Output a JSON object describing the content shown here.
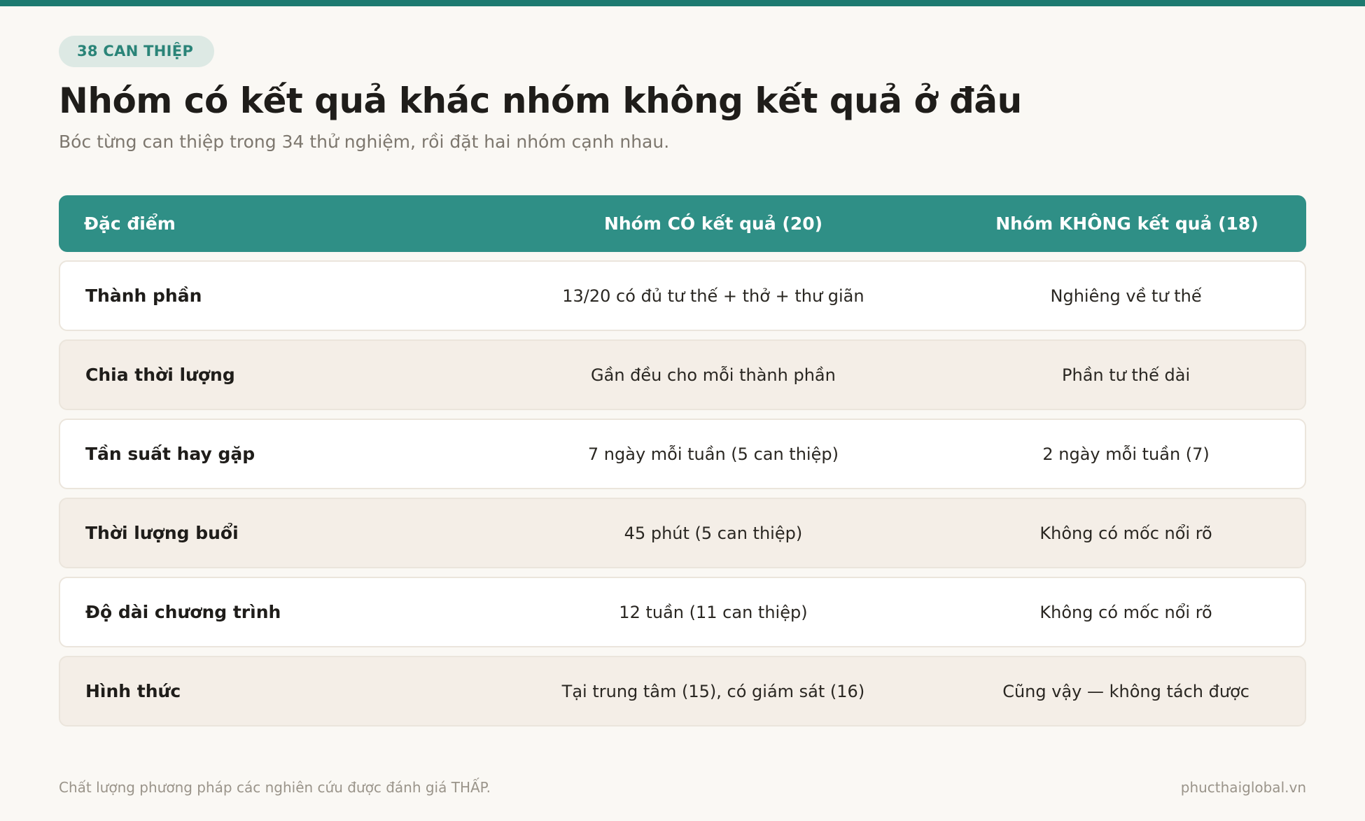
{
  "badge": "38 CAN THIỆP",
  "title": "Nhóm có kết quả khác nhóm không kết quả ở đâu",
  "subtitle": "Bóc từng can thiệp trong 34 thử nghiệm, rồi đặt hai nhóm cạnh nhau.",
  "table": {
    "headers": [
      "Đặc điểm",
      "Nhóm CÓ kết quả (20)",
      "Nhóm KHÔNG kết quả (18)"
    ],
    "rows": [
      [
        "Thành phần",
        "13/20 có đủ tư thế + thở + thư giãn",
        "Nghiêng về tư thế"
      ],
      [
        "Chia thời lượng",
        "Gần đều cho mỗi thành phần",
        "Phần tư thế dài"
      ],
      [
        "Tần suất hay gặp",
        "7 ngày mỗi tuần (5 can thiệp)",
        "2 ngày mỗi tuần (7)"
      ],
      [
        "Thời lượng buổi",
        "45 phút (5 can thiệp)",
        "Không có mốc nổi rõ"
      ],
      [
        "Độ dài chương trình",
        "12 tuần (11 can thiệp)",
        "Không có mốc nổi rõ"
      ],
      [
        "Hình thức",
        "Tại trung tâm (15), có giám sát (16)",
        "Cũng vậy — không tách được"
      ]
    ]
  },
  "footer": {
    "note": "Chất lượng phương pháp các nghiên cứu được đánh giá THẤP.",
    "site": "phucthaiglobal.vn"
  },
  "colors": {
    "accent": "#1d7a70",
    "header_bg": "#2f8f86",
    "badge_bg": "#dde9e4",
    "row_alt_bg": "#f4eee7",
    "page_bg": "#faf8f4"
  }
}
